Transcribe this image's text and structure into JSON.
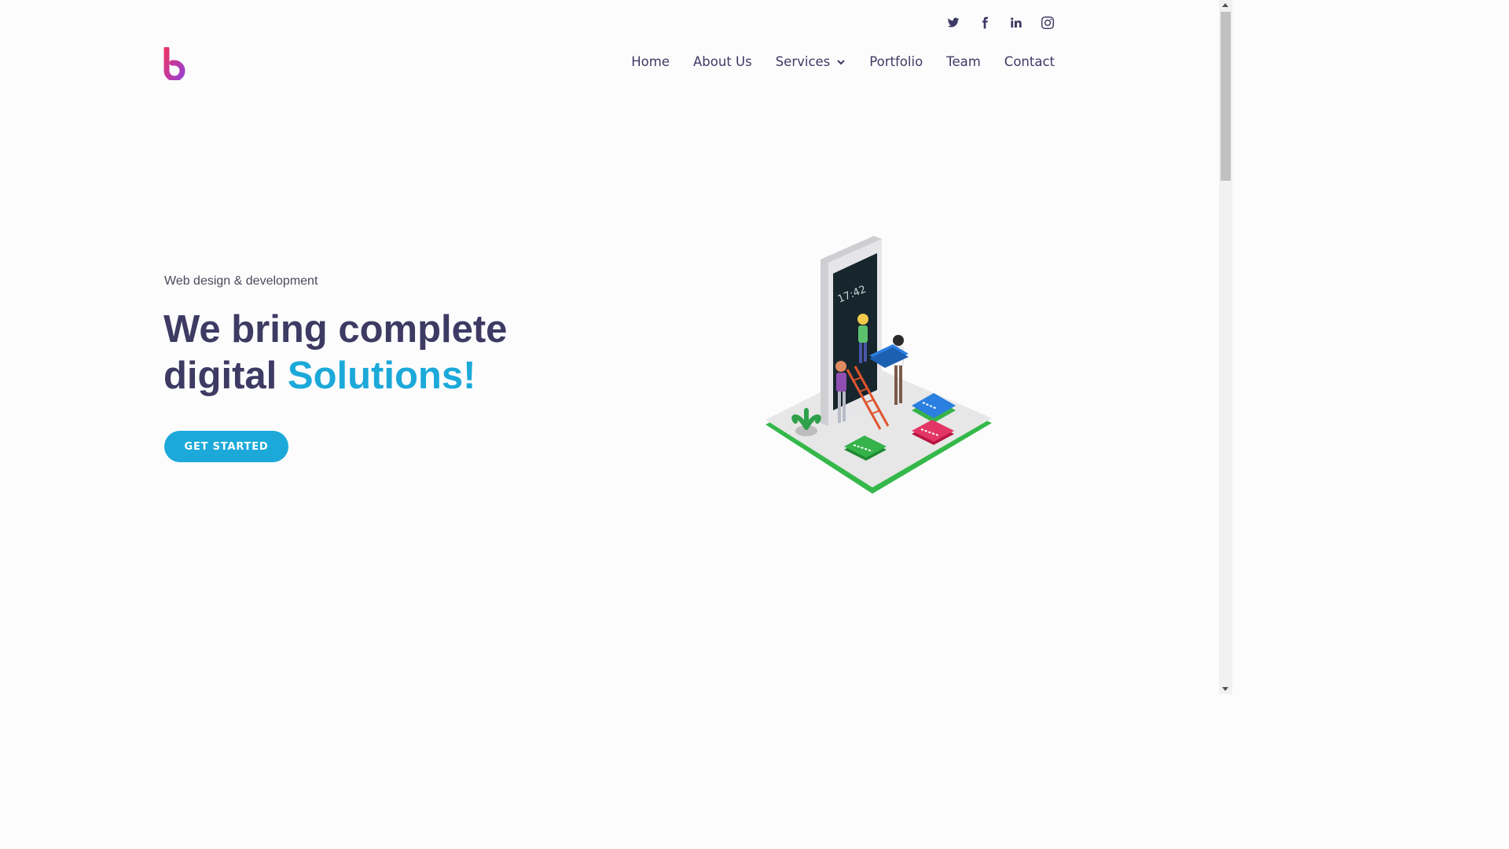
{
  "header": {
    "social": [
      "twitter-icon",
      "facebook-icon",
      "linkedin-icon",
      "instagram-icon"
    ],
    "nav": {
      "home": "Home",
      "about": "About Us",
      "services": "Services",
      "portfolio": "Portfolio",
      "team": "Team",
      "contact": "Contact"
    }
  },
  "hero": {
    "subtitle": "Web design & development",
    "title_line1": "We bring complete",
    "title_line2_plain": "digital ",
    "title_line2_accent": "Solutions!",
    "cta": "GET STARTED",
    "phone_time": "17:42"
  },
  "colors": {
    "primary_text": "#3d3a63",
    "accent": "#1ca9d9",
    "logo_pink": "#e8336b",
    "logo_purple": "#9b3fd1"
  }
}
